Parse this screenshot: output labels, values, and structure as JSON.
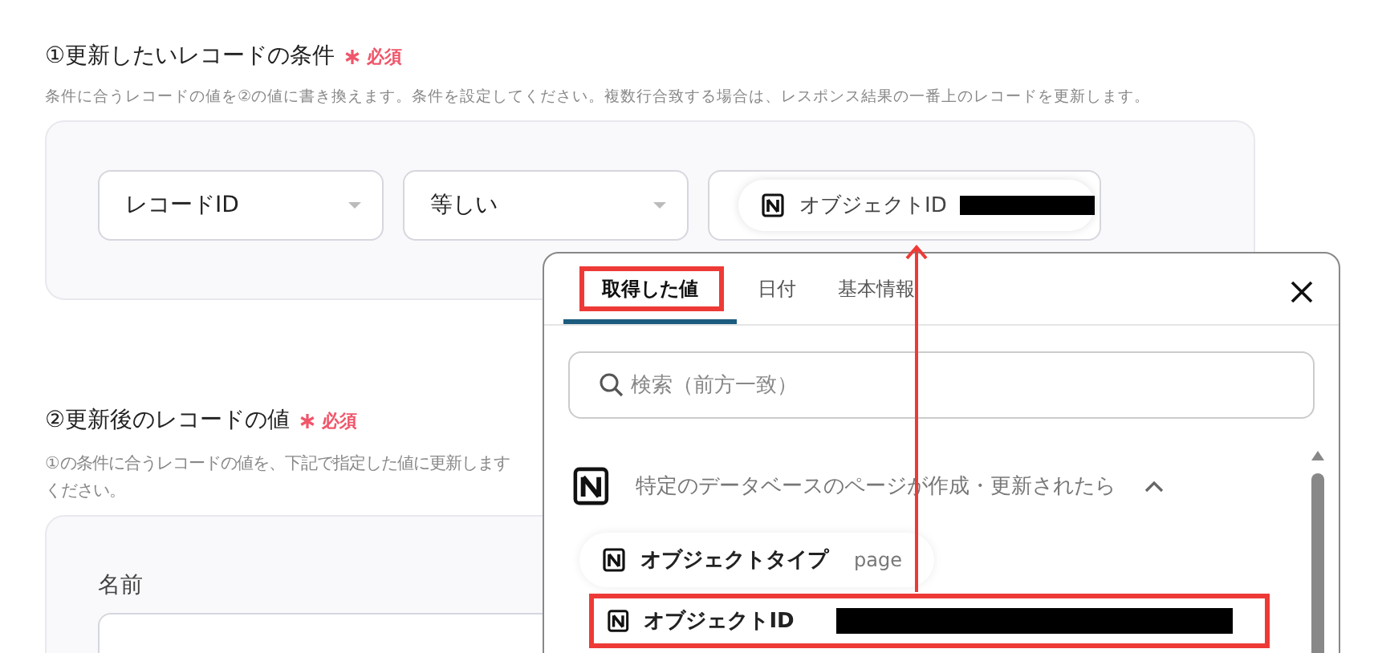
{
  "section1": {
    "title": "①更新したいレコードの条件",
    "required": "必須",
    "description": "条件に合うレコードの値を②の値に書き換えます。条件を設定してください。複数行合致する場合は、レスポンス結果の一番上のレコードを更新します。",
    "condition": {
      "field": "レコードID",
      "operator": "等しい",
      "value_chip": "オブジェクトID"
    }
  },
  "section2": {
    "title": "②更新後のレコードの値",
    "required": "必須",
    "description_lines": [
      "①の条件に合うレコードの値を、下記で指定した値に更新します",
      "ください。"
    ],
    "fields": [
      {
        "label": "名前"
      }
    ]
  },
  "picker": {
    "tabs": [
      {
        "label": "取得した値",
        "selected": true,
        "annotated": true
      },
      {
        "label": "日付",
        "selected": false,
        "annotated": false
      },
      {
        "label": "基本情報",
        "selected": false,
        "annotated": false
      }
    ],
    "search": {
      "placeholder": "検索（前方一致）"
    },
    "group": {
      "title": "特定のデータベースのページが作成・更新されたら",
      "expanded": true,
      "items": [
        {
          "label": "オブジェクトタイプ",
          "value": "page",
          "annotated": false
        },
        {
          "label": "オブジェクトID",
          "annotated": true
        }
      ]
    }
  }
}
